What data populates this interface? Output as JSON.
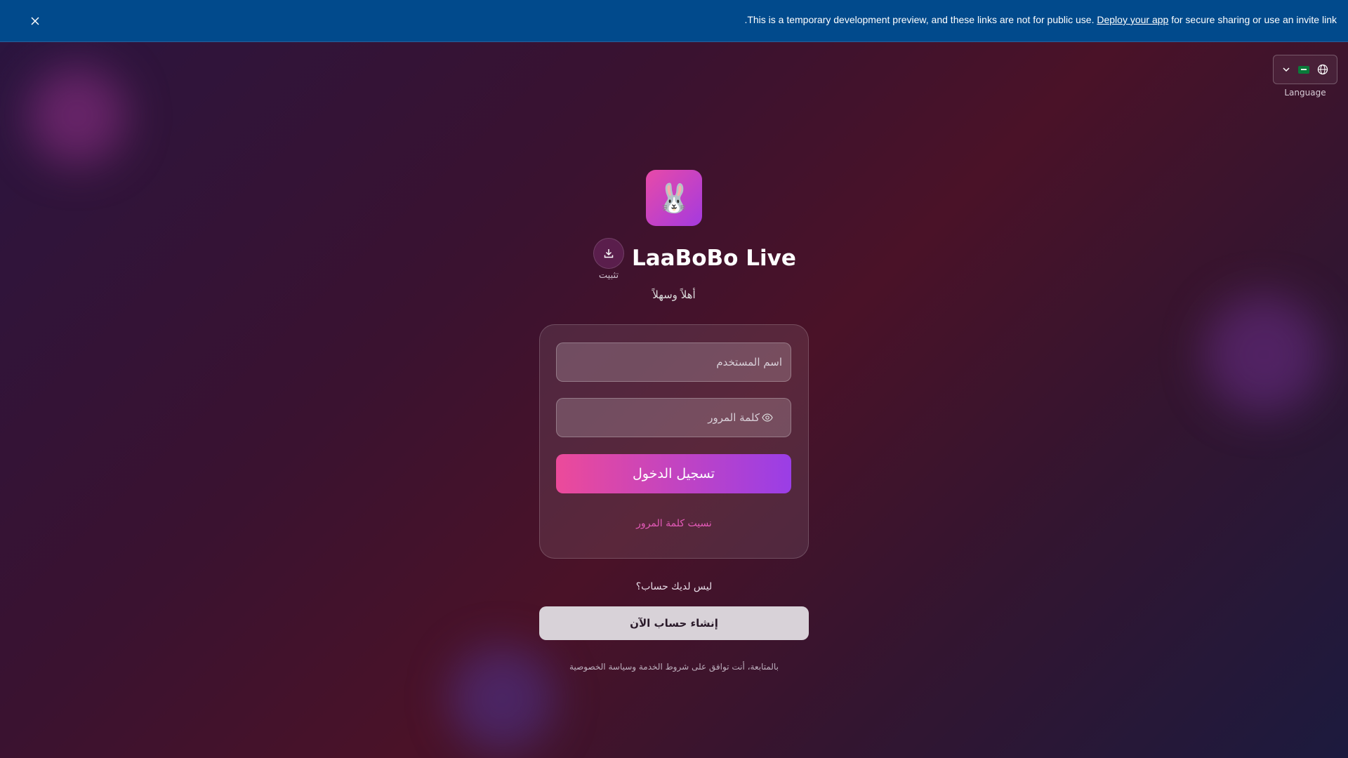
{
  "banner": {
    "text_before": ".This is a temporary development preview, and these links are not for public use. ",
    "link_text": "Deploy your app",
    "text_after": " for secure sharing or use an invite link"
  },
  "language": {
    "caption": "Language",
    "flag_icon": "saudi-flag-icon",
    "globe_icon": "globe-icon",
    "chevron_icon": "chevron-down-icon"
  },
  "brand": {
    "logo_emoji": "🐰",
    "title": "LaaBoBo Live",
    "install_label": "تثبيت",
    "welcome": "أهلاً وسهلاً"
  },
  "login": {
    "username_placeholder": "اسم المستخدم",
    "password_placeholder": "كلمة المرور",
    "submit_label": "تسجيل الدخول",
    "forgot_label": "نسيت كلمة المرور"
  },
  "signup": {
    "prompt": "ليس لديك حساب؟",
    "button_label": "إنشاء حساب الآن"
  },
  "terms": "بالمتابعة، أنت توافق على شروط الخدمة وسياسة الخصوصية",
  "colors": {
    "banner_bg": "#014a8c",
    "accent_pink": "#ec4a9a",
    "accent_purple": "#9a3ee6",
    "link_pink": "#e45ab8"
  }
}
